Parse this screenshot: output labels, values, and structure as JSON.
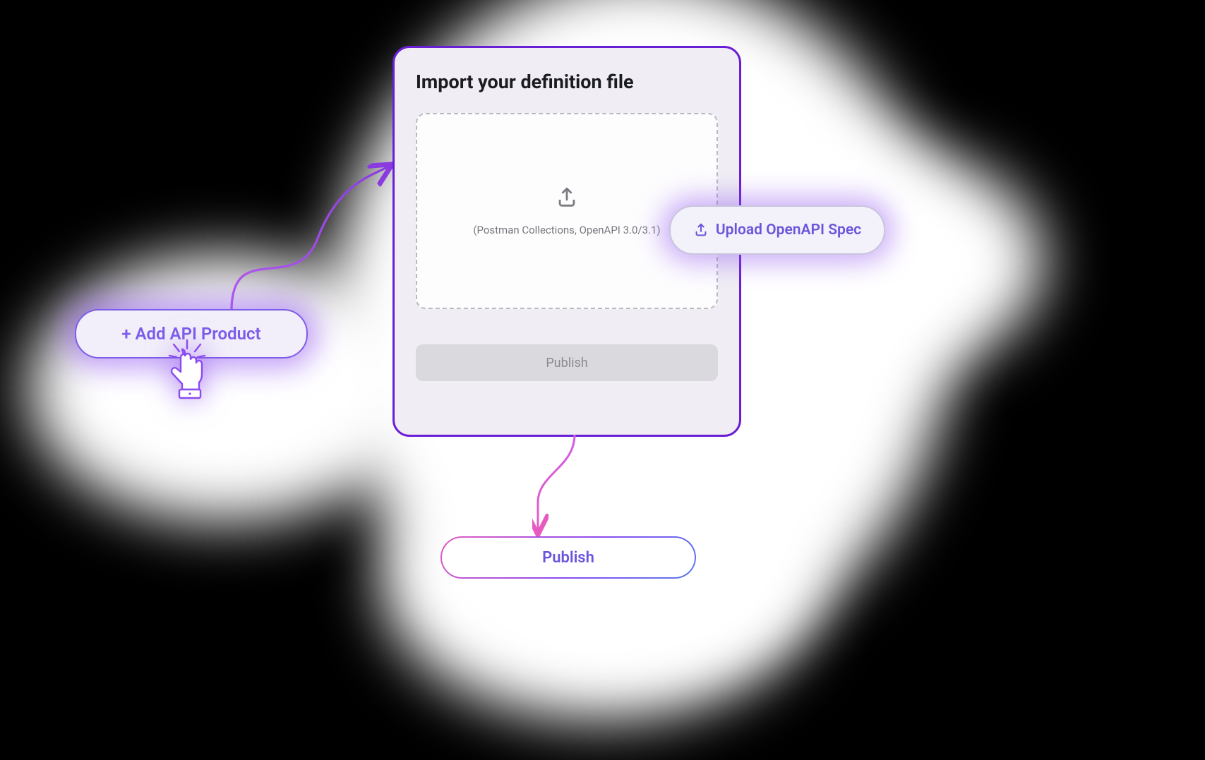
{
  "panel": {
    "title": "Import your definition file",
    "dropzone_hint": "(Postman Collections, OpenAPI 3.0/3.1)",
    "publish_disabled_label": "Publish"
  },
  "pills": {
    "add_api_product": "+ Add API Product",
    "upload_openapi": "Upload OpenAPI Spec",
    "publish": "Publish"
  },
  "icons": {
    "upload_main": "upload-icon",
    "upload_small": "upload-icon",
    "pointer": "pointer-hand-icon"
  },
  "colors": {
    "panel_border": "#6a1fd6",
    "accent_text": "#6a55dd",
    "glow": "#8e50f0"
  }
}
